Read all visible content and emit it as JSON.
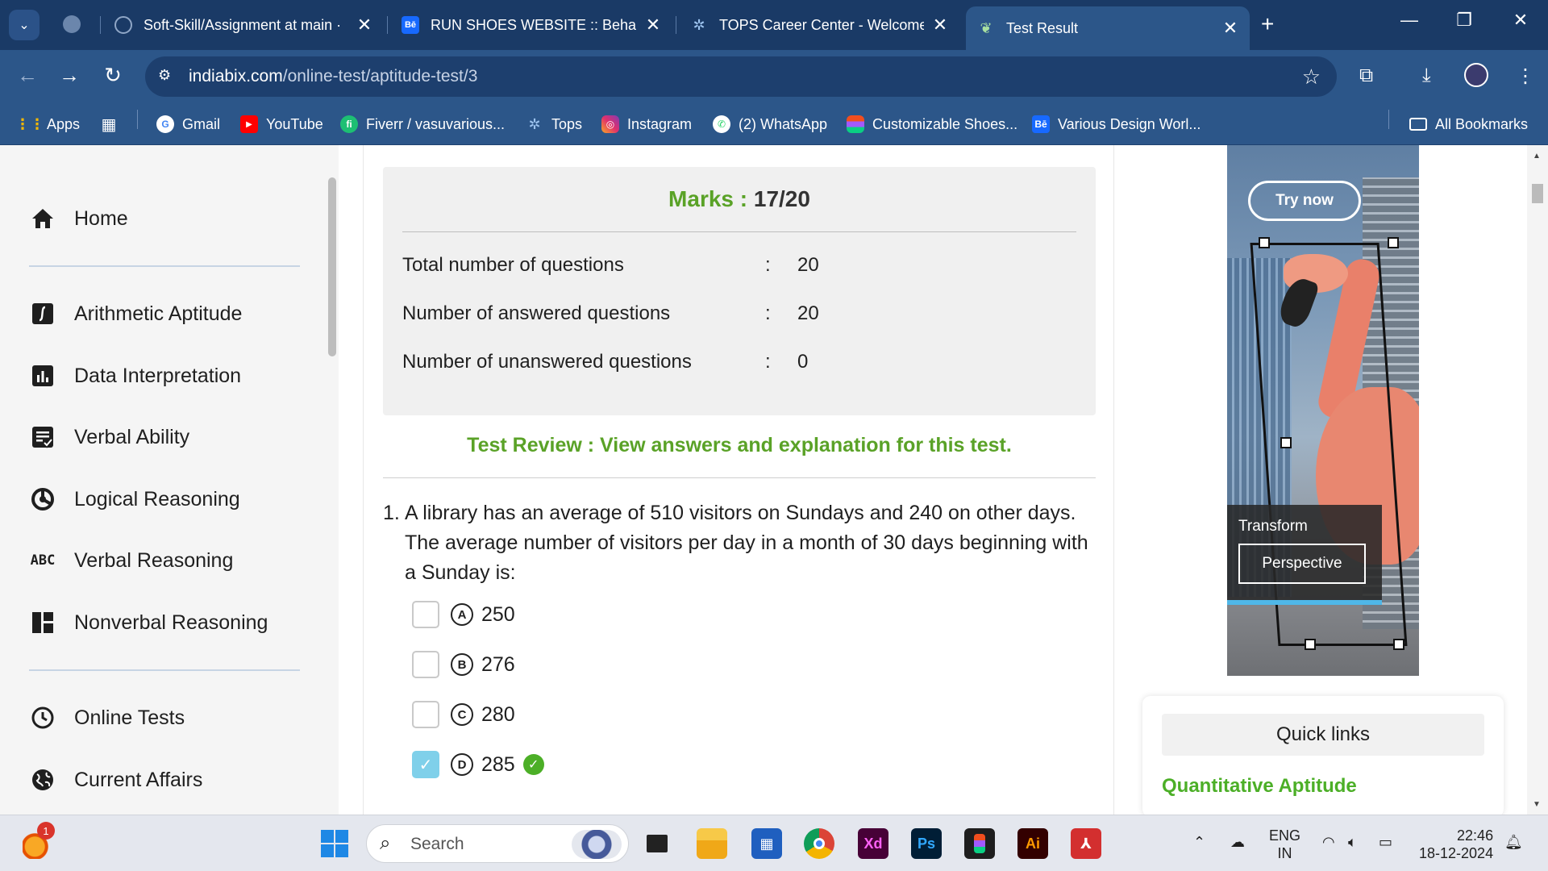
{
  "tabs": [
    {
      "title": "Soft-Skill/Assignment at main ·",
      "icon": "github-icon"
    },
    {
      "title": "RUN SHOES WEBSITE :: Behance",
      "icon": "behance-icon"
    },
    {
      "title": "TOPS Career Center - Welcome",
      "icon": "tops-icon"
    },
    {
      "title": "Test Result",
      "icon": "indiabix-icon"
    }
  ],
  "address": {
    "domain": "indiabix.com",
    "path": "/online-test/aptitude-test/3"
  },
  "bookmarks": [
    {
      "label": "Apps",
      "icon": "apps-grid-icon"
    },
    {
      "label": "Gmail",
      "icon": "google-icon"
    },
    {
      "label": "YouTube",
      "icon": "youtube-icon"
    },
    {
      "label": "Fiverr / vasuvarious...",
      "icon": "fiverr-icon"
    },
    {
      "label": "Tops",
      "icon": "tops-icon"
    },
    {
      "label": "Instagram",
      "icon": "instagram-icon"
    },
    {
      "label": "(2) WhatsApp",
      "icon": "whatsapp-icon"
    },
    {
      "label": "Customizable Shoes...",
      "icon": "figma-icon"
    },
    {
      "label": "Various Design Worl...",
      "icon": "behance-icon"
    },
    {
      "label": "All Bookmarks",
      "icon": "folder-icon"
    }
  ],
  "sidebar": {
    "items": [
      {
        "label": "Home",
        "icon": "home-icon"
      },
      {
        "label": "Arithmetic Aptitude",
        "icon": "integral-icon"
      },
      {
        "label": "Data Interpretation",
        "icon": "bar-chart-icon"
      },
      {
        "label": "Verbal Ability",
        "icon": "document-check-icon"
      },
      {
        "label": "Logical Reasoning",
        "icon": "logic-icon"
      },
      {
        "label": "Verbal Reasoning",
        "icon": "abc-icon",
        "icon_text": "ABC"
      },
      {
        "label": "Nonverbal Reasoning",
        "icon": "dashboard-icon"
      },
      {
        "label": "Online Tests",
        "icon": "clock-icon"
      },
      {
        "label": "Current Affairs",
        "icon": "globe-icon"
      }
    ]
  },
  "result": {
    "marks_label": "Marks :",
    "marks_value": "17/20",
    "stats": [
      {
        "label": "Total number of questions",
        "value": "20"
      },
      {
        "label": "Number of answered questions",
        "value": "20"
      },
      {
        "label": "Number of unanswered questions",
        "value": "0"
      }
    ],
    "review_text": "Test Review : View answers and explanation for this test."
  },
  "question": {
    "number": "1.",
    "text": "A library has an average of 510 visitors on Sundays and 240 on other days. The average number of visitors per day in a month of 30 days beginning with a Sunday is:",
    "options": [
      {
        "letter": "A",
        "value": "250",
        "checked": false,
        "correct": false
      },
      {
        "letter": "B",
        "value": "276",
        "checked": false,
        "correct": false
      },
      {
        "letter": "C",
        "value": "280",
        "checked": false,
        "correct": false
      },
      {
        "letter": "D",
        "value": "285",
        "checked": true,
        "correct": true
      }
    ]
  },
  "ad": {
    "try_label": "Try now",
    "panel_title": "Transform",
    "panel_button": "Perspective"
  },
  "quick_links": {
    "heading": "Quick links",
    "first_link": "Quantitative Aptitude"
  },
  "taskbar": {
    "search_placeholder": "Search",
    "lang_top": "ENG",
    "lang_bottom": "IN",
    "time": "22:46",
    "date": "18-12-2024",
    "notification_count": "1"
  },
  "colors": {
    "accent_green": "#5aa227",
    "chrome_blue": "#2c5689",
    "checked_box": "#7fd0ea"
  }
}
